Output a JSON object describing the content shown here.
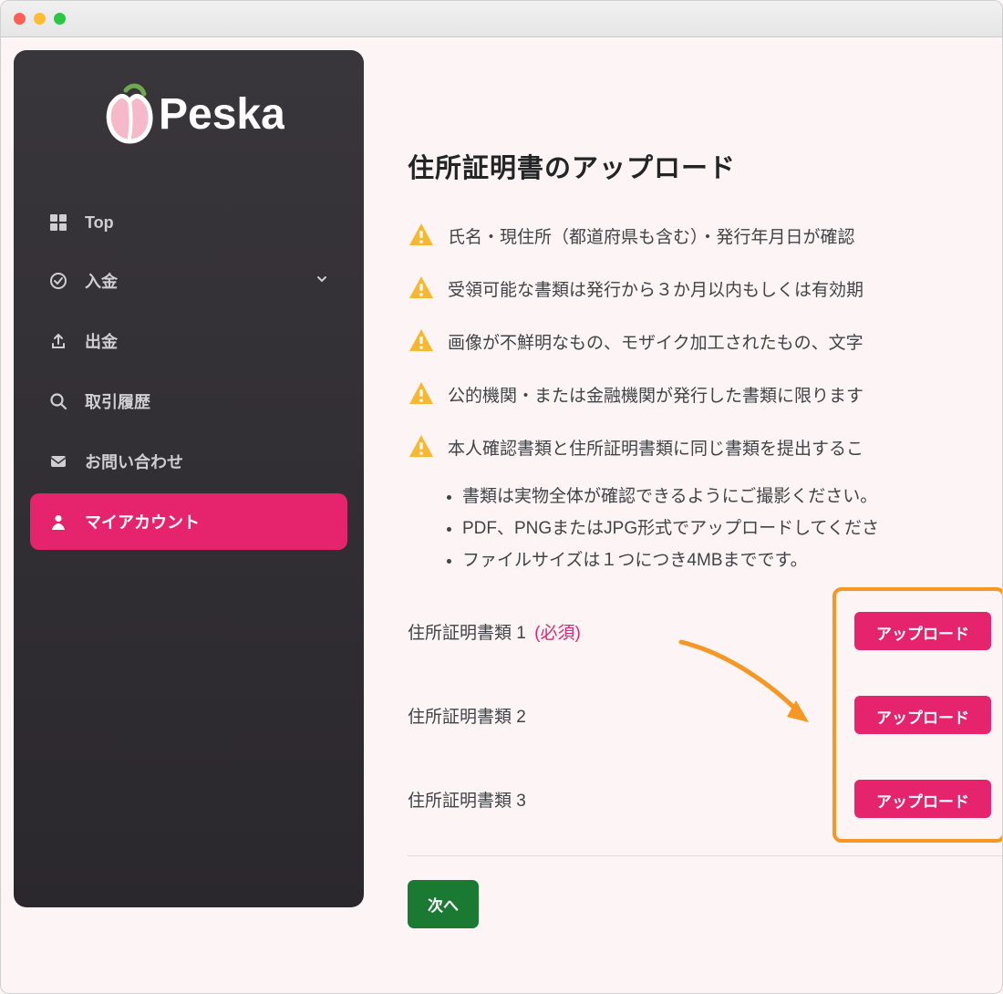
{
  "brand": {
    "name": "Peska"
  },
  "sidebar": {
    "items": [
      {
        "label": "Top"
      },
      {
        "label": "入金"
      },
      {
        "label": "出金"
      },
      {
        "label": "取引履歴"
      },
      {
        "label": "お問い合わせ"
      },
      {
        "label": "マイアカウント"
      }
    ]
  },
  "main": {
    "title": "住所証明書のアップロード",
    "warnings": [
      "氏名・現住所（都道府県も含む）・発行年月日が確認",
      "受領可能な書類は発行から３か月以内もしくは有効期",
      "画像が不鮮明なもの、モザイク加工されたもの、文字",
      "公的機関・または金融機関が発行した書類に限ります",
      "本人確認書類と住所証明書類に同じ書類を提出するこ"
    ],
    "bullets": [
      "書類は実物全体が確認できるようにご撮影ください。",
      "PDF、PNGまたはJPG形式でアップロードしてくださ",
      "ファイルサイズは１つにつき4MBまでです。"
    ],
    "upload": {
      "rows": [
        {
          "label": "住所証明書類 1",
          "required_text": "(必須)"
        },
        {
          "label": "住所証明書類 2",
          "required_text": ""
        },
        {
          "label": "住所証明書類 3",
          "required_text": ""
        }
      ],
      "button_label": "アップロード"
    },
    "next_label": "次へ"
  }
}
